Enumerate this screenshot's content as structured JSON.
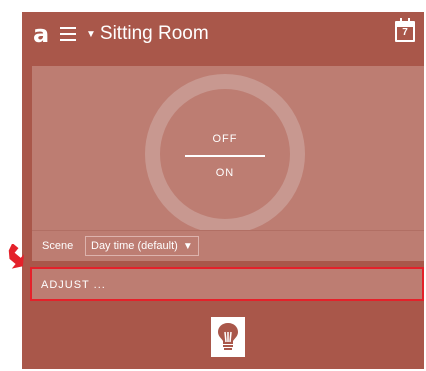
{
  "header": {
    "logo_text": "a",
    "room_name": "Sitting Room",
    "room_caret": "▼",
    "calendar_day": "7"
  },
  "dial": {
    "off_label": "OFF",
    "on_label": "ON"
  },
  "scene": {
    "label": "Scene",
    "selected": "Day time (default)",
    "caret": "▼"
  },
  "adjust": {
    "label": "ADJUST ..."
  },
  "colors": {
    "background": "#a9574a",
    "panel": "#bd7d72",
    "highlight": "#e4212a"
  },
  "icons": [
    "menu-icon",
    "calendar-icon",
    "lightbulb-icon",
    "arrow-pointer-icon"
  ]
}
